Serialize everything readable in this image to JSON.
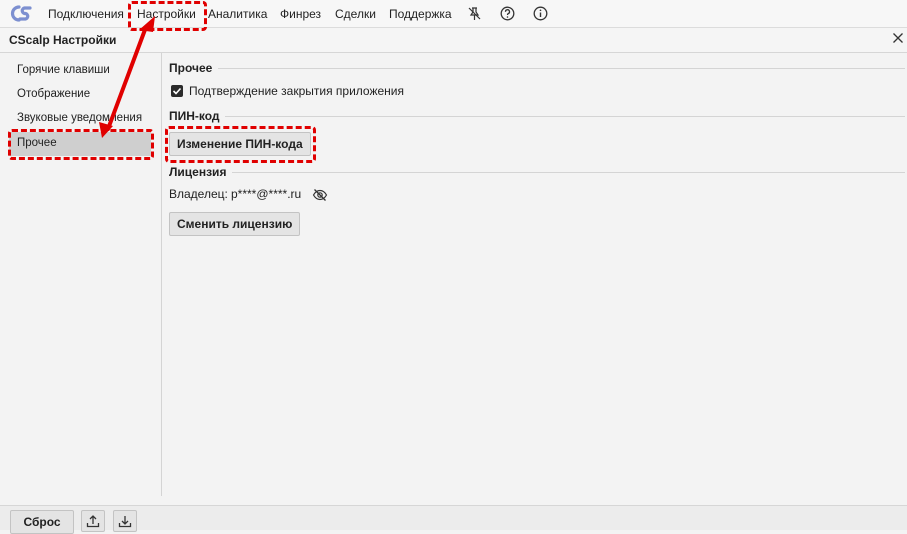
{
  "topbar": {
    "menu": [
      "Подключения",
      "Настройки",
      "Аналитика",
      "Финрез",
      "Сделки",
      "Поддержка"
    ],
    "icons": [
      "pin-off-icon",
      "help-circle-icon",
      "info-circle-icon"
    ],
    "accent": "#6b7fc7"
  },
  "window": {
    "title": "CScalp Настройки",
    "close_icon": "close-icon"
  },
  "sidebar": {
    "items": [
      "Горячие клавиши",
      "Отображение",
      "Звуковые уведомления",
      "Прочее"
    ],
    "active_index": 3
  },
  "main": {
    "section_other": "Прочее",
    "checkbox_label": "Подтверждение закрытия приложения",
    "checkbox_checked": true,
    "section_pin": "ПИН-код",
    "pin_button": "Изменение ПИН-кода",
    "section_license": "Лицензия",
    "owner_label": "Владелец:",
    "owner_value": "p****@****.ru",
    "eye_icon": "eye-off-icon",
    "change_license_button": "Сменить лицензию"
  },
  "bottom": {
    "reset_button": "Сброс",
    "upload_icon": "upload-icon",
    "download_icon": "download-icon"
  },
  "annotations": {
    "color": "#e00000"
  }
}
